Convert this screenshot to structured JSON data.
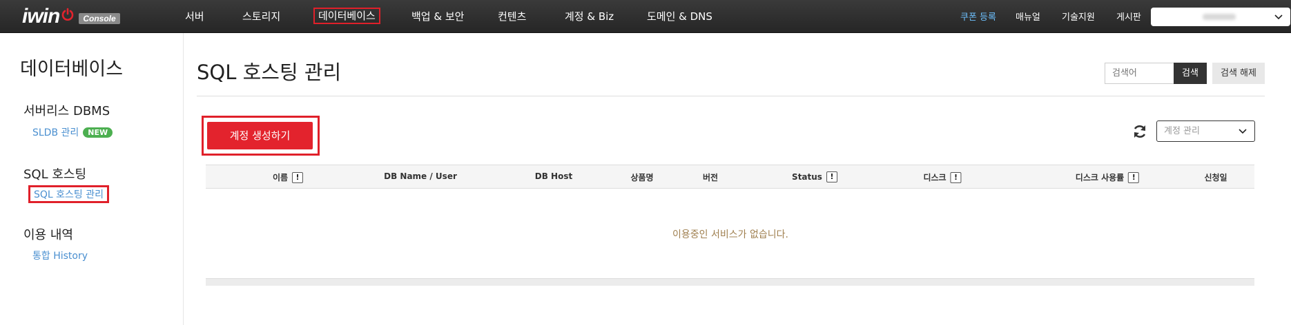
{
  "header": {
    "logo_text": "iwin",
    "logo_badge": "Console",
    "nav": [
      "서버",
      "스토리지",
      "데이터베이스",
      "백업 & 보안",
      "컨텐츠",
      "계정 & Biz",
      "도메인 & DNS"
    ],
    "active_nav": "데이터베이스",
    "utils": {
      "coupon": "쿠폰 등록",
      "manual": "매뉴얼",
      "support": "기술지원",
      "board": "게시판"
    },
    "account_select_icon": "chevron-down-icon"
  },
  "sidebar": {
    "title": "데이터베이스",
    "groups": [
      {
        "label": "서버리스 DBMS",
        "links": [
          {
            "label": "SLDB 관리",
            "badge": "NEW"
          }
        ]
      },
      {
        "label": "SQL 호스팅",
        "links": [
          {
            "label": "SQL 호스팅 관리"
          }
        ]
      },
      {
        "label": "이용 내역",
        "links": [
          {
            "label": "통합 History"
          }
        ]
      }
    ]
  },
  "main": {
    "title": "SQL 호스팅 관리",
    "search": {
      "placeholder": "검색어",
      "button": "검색",
      "reset": "검색 해제"
    },
    "create_button": "계정 생성하기",
    "manage_select": "계정 관리",
    "table": {
      "columns": [
        {
          "label": "이름",
          "info": true
        },
        {
          "label": "DB Name / User",
          "info": false
        },
        {
          "label": "DB Host",
          "info": false
        },
        {
          "label": "상품명",
          "info": false
        },
        {
          "label": "버전",
          "info": false
        },
        {
          "label": "Status",
          "info": true
        },
        {
          "label": "디스크",
          "info": true
        },
        {
          "label": "디스크 사용률",
          "info": true
        },
        {
          "label": "신청일",
          "info": false
        }
      ],
      "empty_message": "이용중인 서비스가 없습니다."
    }
  },
  "colors": {
    "accent_red": "#e3232d",
    "link_blue": "#4a8fd0",
    "new_badge": "#4caf50",
    "empty_text": "#a08050"
  }
}
